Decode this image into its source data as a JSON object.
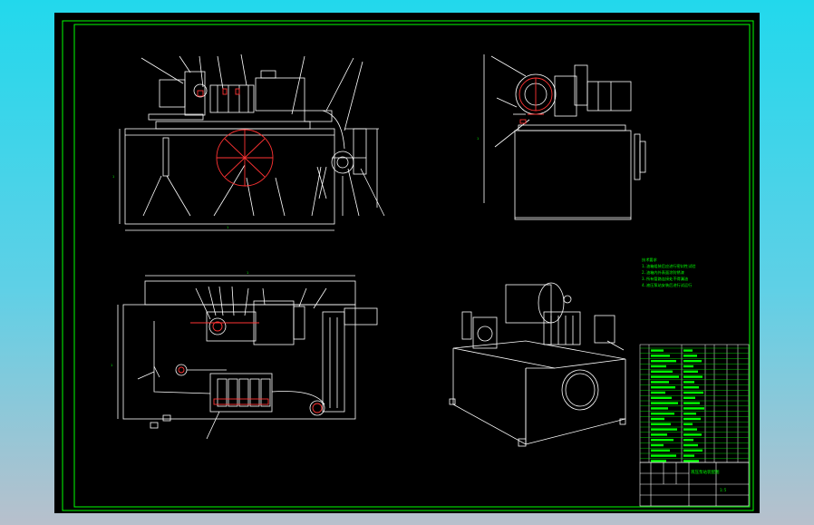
{
  "drawing": {
    "frame_color": "#00ff00",
    "line_color": "#ffffff",
    "accent_color": "#ff3333",
    "background": "#000000",
    "dims": {
      "front_height": "1",
      "front_width": "1",
      "top_width": "1",
      "top_height": "1",
      "side_height": "1"
    },
    "tech_notes": [
      "技术要求",
      "1.油箱组装后应进行密封性试验",
      "2.油箱内外表面涂防锈漆",
      "3.所有管路连接处不得漏油",
      "4.液压泵站安装后进行试运行"
    ],
    "title_block": {
      "title": "液压泵站装配图",
      "scale": "1:5"
    }
  }
}
